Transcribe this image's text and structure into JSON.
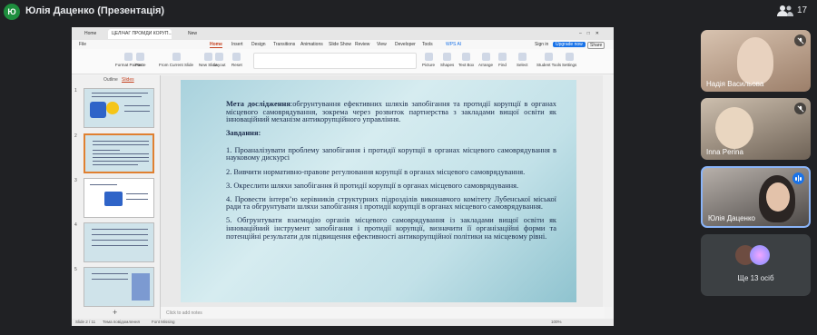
{
  "meeting": {
    "presenter_initials": "Ю",
    "presenter_title": "Юлія Даценко (Презентація)",
    "participant_count": "17"
  },
  "ppt": {
    "tabs": [
      "Home",
      "ЦЕЛІЧАГ ПРОМДИ КОРУП...",
      "New"
    ],
    "menu": [
      "File",
      "Home",
      "Insert",
      "Design",
      "Transitions",
      "Animations",
      "Slide Show",
      "Review",
      "View",
      "Developer",
      "Tools",
      "WPS AI"
    ],
    "active_menu": "Home",
    "right_controls": [
      "Sign in",
      "Upgrade now",
      "Share"
    ],
    "ribbon": [
      "Format Painter",
      "Paste",
      "From Current Slide",
      "New Slide",
      "Layout",
      "Reset",
      "Section",
      "Picture",
      "Shapes",
      "Text Box",
      "Arrange",
      "Find",
      "Replace",
      "Select",
      "Student Tools",
      "Settings"
    ],
    "side_tabs": [
      "Outline",
      "Slides"
    ],
    "thumbnail_numbers": [
      "1",
      "2",
      "3",
      "4",
      "5"
    ],
    "notes_placeholder": "Click to add notes",
    "status_left": "Slide 2 / 11",
    "status_theme": "Тема повідомлення",
    "status_font": "Font Missing",
    "status_zoom": "100%"
  },
  "slide": {
    "heading_bold": "Мета дослідження",
    "heading_rest": ":обгрунтування ефективних шляхів запобігання та протидії корупції в органах місцевого самоврядування, зокрема через розвиток партнерства з закладами вищої освіти як інноваційний механізм антикорупційного управління.",
    "tasks_title": "Завдання:",
    "tasks": [
      "1.        Проаналізувати проблему запобігання і протидії корупції в органах місцевого самоврядування в науковому дискурсі",
      "2.        Вивчити нормативно-правове регулювання корупції в органах місцевого самоврядування.",
      "3.        Окреслити шляхи запобігання й протидії корупції в органах місцевого самоврядування.",
      "4.        Провести інтерв’ю керівників структурних підрозділів виконавчого комітету Лубенської міської ради та обгрунтувати шляхи запобігання і протидії корупції в органах місцевого самоврядування.",
      "5.        Обгрунтувати взаємодію органів місцевого самоврядування із закладами вищої освіти як інноваційний інструмент запобігання і протидії корупції, визначити її організаційні форми та потенційні результати для підвищення ефективності антикорупційної політики на місцевому рівні."
    ]
  },
  "participants": [
    {
      "name": "Надія Васильова",
      "muted": true
    },
    {
      "name": "Inna Perina",
      "muted": true
    },
    {
      "name": "Юлія Даценко",
      "speaking": true
    }
  ],
  "others": {
    "label": "Ще 13 осіб"
  },
  "colors": {
    "meet_bg": "#202124",
    "accent": "#1a73e8",
    "presenter_avatar": "#1e8e3e",
    "ppt_active": "#c43e1c"
  }
}
